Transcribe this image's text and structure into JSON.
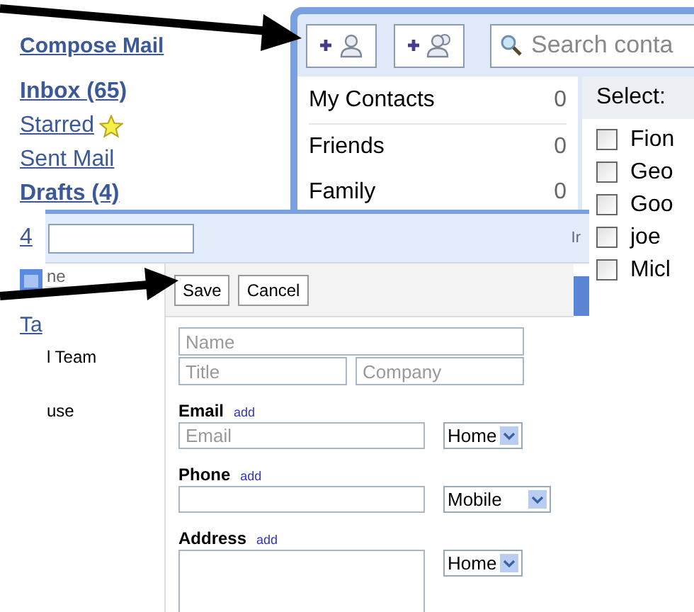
{
  "mail_nav": {
    "compose": "Compose Mail",
    "folders": [
      {
        "label": "Inbox (65)",
        "unread": true,
        "kind": "plain"
      },
      {
        "label": "Starred",
        "unread": false,
        "kind": "starred"
      },
      {
        "label": "Sent Mail",
        "unread": false,
        "kind": "plain"
      },
      {
        "label": "Drafts (4)",
        "unread": true,
        "kind": "plain"
      }
    ],
    "fragments": [
      "4",
      "Ta"
    ]
  },
  "contacts": {
    "search": {
      "placeholder": "Search conta"
    },
    "groups": [
      {
        "name": "My Contacts",
        "count": "0"
      },
      {
        "name": "Friends",
        "count": "0"
      },
      {
        "name": "Family",
        "count": "0"
      }
    ],
    "select_label": "Select:",
    "people": [
      {
        "name": "Fion",
        "checked": false
      },
      {
        "name": "Geo",
        "checked": false
      },
      {
        "name": "Goo",
        "checked": false
      },
      {
        "name": "joe",
        "checked": false
      },
      {
        "name": "Micl",
        "checked": false
      }
    ]
  },
  "editor": {
    "header_fragment": "Ir",
    "list_fragments": [
      "ne",
      "l Team",
      "use"
    ],
    "buttons": [
      "Save",
      "Cancel"
    ],
    "name_placeholder": "Name",
    "title_placeholder": "Title",
    "company_placeholder": "Company",
    "sections": [
      {
        "label": "Email",
        "add": "add",
        "kind": "input",
        "placeholder": "Email",
        "type": "Home"
      },
      {
        "label": "Phone",
        "add": "add",
        "kind": "input",
        "type": "Mobile"
      },
      {
        "label": "Address",
        "add": "add",
        "kind": "textarea",
        "type": "Home"
      }
    ]
  }
}
